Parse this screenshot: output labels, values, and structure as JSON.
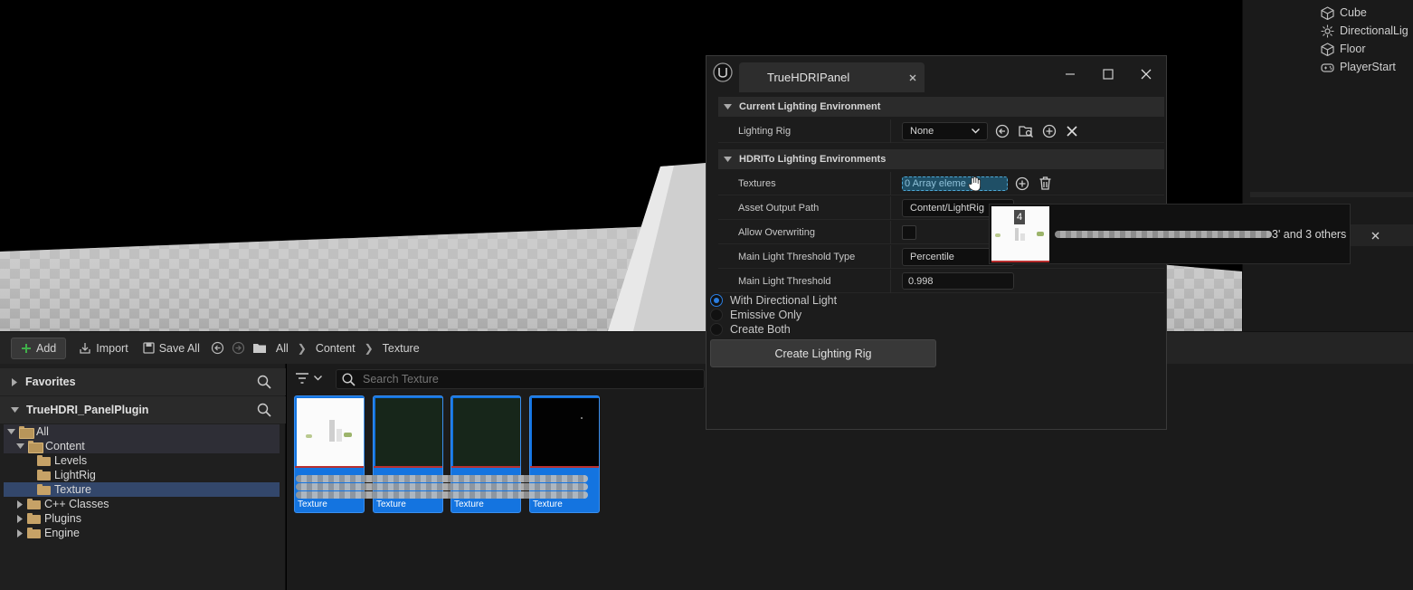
{
  "outliner": {
    "items": [
      {
        "label": "Cube",
        "icon": "cube-icon"
      },
      {
        "label": "DirectionalLig",
        "icon": "light-icon"
      },
      {
        "label": "Floor",
        "icon": "cube-icon"
      },
      {
        "label": "PlayerStart",
        "icon": "gamepad-icon"
      }
    ]
  },
  "toolbar": {
    "add_label": "Add",
    "import_label": "Import",
    "save_all_label": "Save All",
    "breadcrumb": [
      "All",
      "Content",
      "Texture"
    ]
  },
  "sources": {
    "favorites_label": "Favorites",
    "plugin_label": "TrueHDRI_PanelPlugin",
    "tree": [
      {
        "label": "All"
      },
      {
        "label": "Content"
      },
      {
        "label": "Levels"
      },
      {
        "label": "LightRig"
      },
      {
        "label": "Texture"
      },
      {
        "label": "C++ Classes"
      },
      {
        "label": "Plugins"
      },
      {
        "label": "Engine"
      }
    ]
  },
  "assets": {
    "search_placeholder": "Search Texture",
    "tiles": [
      {
        "type_label": "Texture",
        "thumb": "white-scene"
      },
      {
        "type_label": "Texture",
        "thumb": "dark-green"
      },
      {
        "type_label": "Texture",
        "thumb": "dark-green"
      },
      {
        "type_label": "Texture",
        "thumb": "black"
      }
    ]
  },
  "panel": {
    "tab_title": "TrueHDRIPanel",
    "section1_title": "Current Lighting Environment",
    "lighting_rig_label": "Lighting Rig",
    "lighting_rig_value": "None",
    "section2_title": "HDRITo Lighting Environments",
    "textures_label": "Textures",
    "textures_value": "0 Array eleme",
    "asset_output_label": "Asset Output Path",
    "asset_output_value": "Content/LightRig",
    "allow_overwriting_label": "Allow Overwriting",
    "threshold_type_label": "Main Light Threshold Type",
    "threshold_type_value": "Percentile",
    "threshold_label": "Main Light Threshold",
    "threshold_value": "0.998",
    "radio_options": [
      {
        "label": "With Directional Light",
        "selected": true
      },
      {
        "label": "Emissive Only",
        "selected": false
      },
      {
        "label": "Create Both",
        "selected": false
      }
    ],
    "create_button_label": "Create Lighting Rig"
  },
  "drag_tooltip": {
    "count": "4",
    "suffix": "3' and 3 others"
  },
  "colors": {
    "accent": "#1474e0",
    "folder": "#c6a267",
    "selection": "#33476b"
  }
}
